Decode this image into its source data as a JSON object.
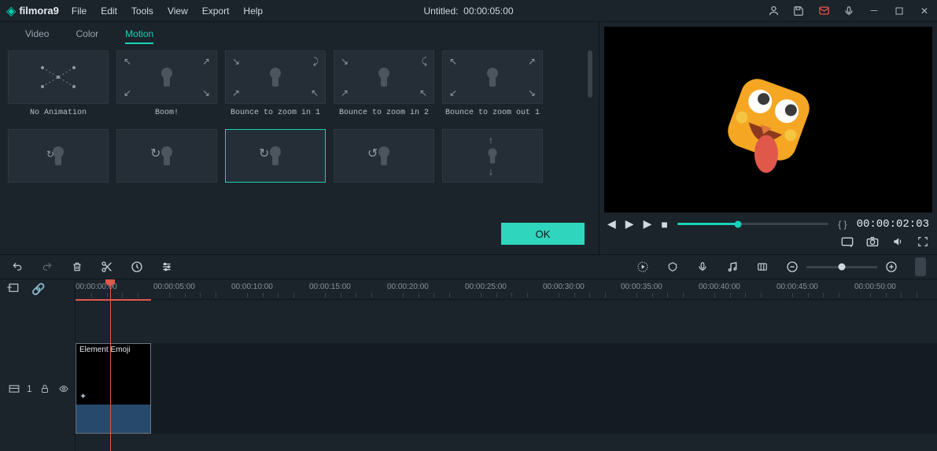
{
  "app": {
    "name": "filmora9"
  },
  "menu": {
    "file": "File",
    "edit": "Edit",
    "tools": "Tools",
    "view": "View",
    "export": "Export",
    "help": "Help"
  },
  "title": {
    "project": "Untitled:",
    "duration": "00:00:05:00"
  },
  "tabs": {
    "video": "Video",
    "color": "Color",
    "motion": "Motion"
  },
  "motion_presets": [
    {
      "label": "No Animation"
    },
    {
      "label": "Boom!"
    },
    {
      "label": "Bounce to zoom in 1"
    },
    {
      "label": "Bounce to zoom in 2"
    },
    {
      "label": "Bounce to zoom out 1"
    },
    {
      "label": ""
    },
    {
      "label": ""
    },
    {
      "label": "",
      "selected": true
    },
    {
      "label": ""
    },
    {
      "label": ""
    }
  ],
  "ok_button": "OK",
  "preview": {
    "timecode": "00:00:02:03",
    "brackets": "{  }"
  },
  "ruler_ticks": [
    "00:00:00:00",
    "00:00:05:00",
    "00:00:10:00",
    "00:00:15:00",
    "00:00:20:00",
    "00:00:25:00",
    "00:00:30:00",
    "00:00:35:00",
    "00:00:40:00",
    "00:00:45:00",
    "00:00:50:00"
  ],
  "track": {
    "clip_name": "Element Emoji",
    "track_index": "1"
  },
  "colors": {
    "accent": "#16d3b6",
    "bg": "#1b232b"
  }
}
